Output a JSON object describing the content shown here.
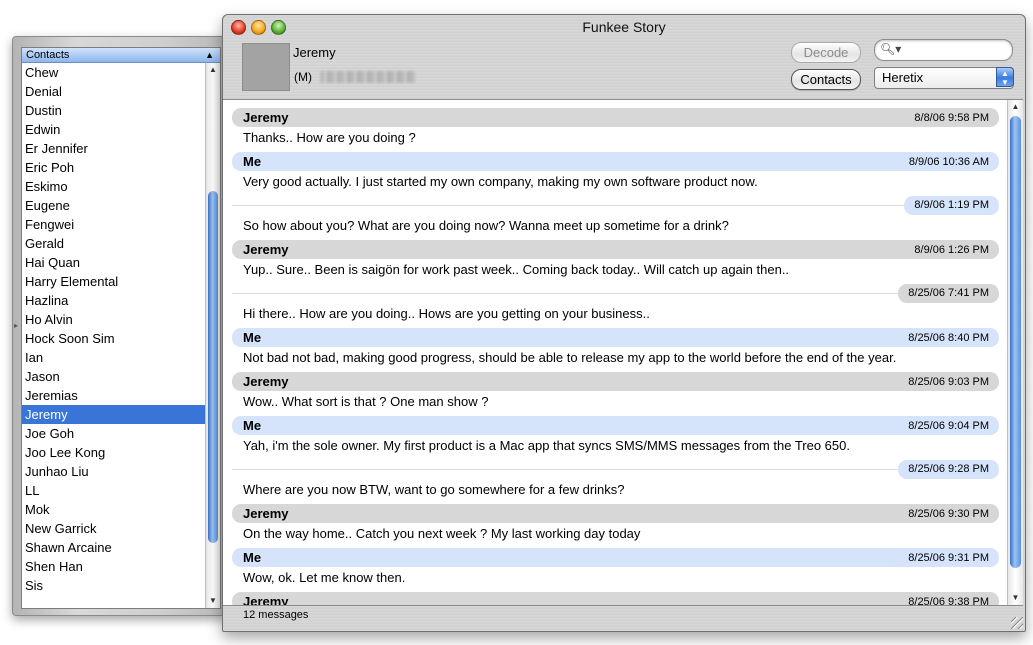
{
  "window": {
    "title": "Funkee Story"
  },
  "contacts_panel": {
    "column_header": "Contacts",
    "sort_indicator": "▲",
    "items": [
      "Chew",
      "Denial",
      "Dustin",
      "Edwin",
      "Er Jennifer",
      "Eric Poh",
      "Eskimo",
      "Eugene",
      "Fengwei",
      "Gerald",
      "Hai Quan",
      "Harry Elemental",
      "Hazlina",
      "Ho Alvin",
      "Hock Soon Sim",
      "Ian",
      "Jason",
      "Jeremias",
      "Jeremy",
      "Joe Goh",
      "Joo Lee Kong",
      "Junhao Liu",
      "LL",
      "Mok",
      "New Garrick",
      "Shawn Arcaine",
      "Shen Han",
      "Sis"
    ],
    "selected": "Jeremy"
  },
  "header": {
    "contact_name": "Jeremy",
    "phone_label": "(M)",
    "decode_label": "Decode",
    "contacts_label": "Contacts",
    "search_value": "",
    "search_placeholder": "",
    "account_selected": "Heretix"
  },
  "messages": [
    {
      "sender": "Jeremy",
      "side": "them",
      "date": "8/8/06 9:58 PM",
      "text": "Thanks.. How are you doing ?",
      "show_header": true
    },
    {
      "sender": "Me",
      "side": "me",
      "date": "8/9/06 10:36 AM",
      "text": "Very good actually. I just started my own company, making my own software product now.",
      "show_header": true
    },
    {
      "sender": "Me",
      "side": "me",
      "date": "8/9/06 1:19 PM",
      "text": "So how about you? What are you doing now? Wanna meet up sometime for a drink?",
      "show_header": false
    },
    {
      "sender": "Jeremy",
      "side": "them",
      "date": "8/9/06 1:26 PM",
      "text": "Yup.. Sure.. Been is saigön for work past week.. Coming back today.. Will catch up again then..",
      "show_header": true
    },
    {
      "sender": "Jeremy",
      "side": "them",
      "date": "8/25/06 7:41 PM",
      "text": "Hi there.. How are you doing.. Hows are you getting on your business..",
      "show_header": false
    },
    {
      "sender": "Me",
      "side": "me",
      "date": "8/25/06 8:40 PM",
      "text": "Not bad not bad, making good progress, should be able to release my app to the world before the end of the year.",
      "show_header": true
    },
    {
      "sender": "Jeremy",
      "side": "them",
      "date": "8/25/06 9:03 PM",
      "text": "Wow.. What sort is that ? One man show ?",
      "show_header": true
    },
    {
      "sender": "Me",
      "side": "me",
      "date": "8/25/06 9:04 PM",
      "text": "Yah, i'm the sole owner. My first product is a Mac app that syncs SMS/MMS messages from the Treo 650.",
      "show_header": true
    },
    {
      "sender": "Me",
      "side": "me",
      "date": "8/25/06 9:28 PM",
      "text": "Where are you now BTW, want to go somewhere for a few drinks?",
      "show_header": false
    },
    {
      "sender": "Jeremy",
      "side": "them",
      "date": "8/25/06 9:30 PM",
      "text": "On the way home.. Catch you next week ? My last working day today",
      "show_header": true
    },
    {
      "sender": "Me",
      "side": "me",
      "date": "8/25/06 9:31 PM",
      "text": "Wow, ok. Let me know then.",
      "show_header": true
    },
    {
      "sender": "Jeremy",
      "side": "them",
      "date": "8/25/06 9:38 PM",
      "text": "",
      "show_header": true
    }
  ],
  "status": {
    "message_count": "12 messages"
  },
  "colors": {
    "selection": "#3875d7",
    "them_bubble": "#d7d7d7",
    "me_bubble": "#d5e3fb",
    "scroll_thumb": "#5b90db"
  },
  "icons": {
    "search": "magnifier-icon",
    "popup": "up-down-arrows-icon"
  }
}
